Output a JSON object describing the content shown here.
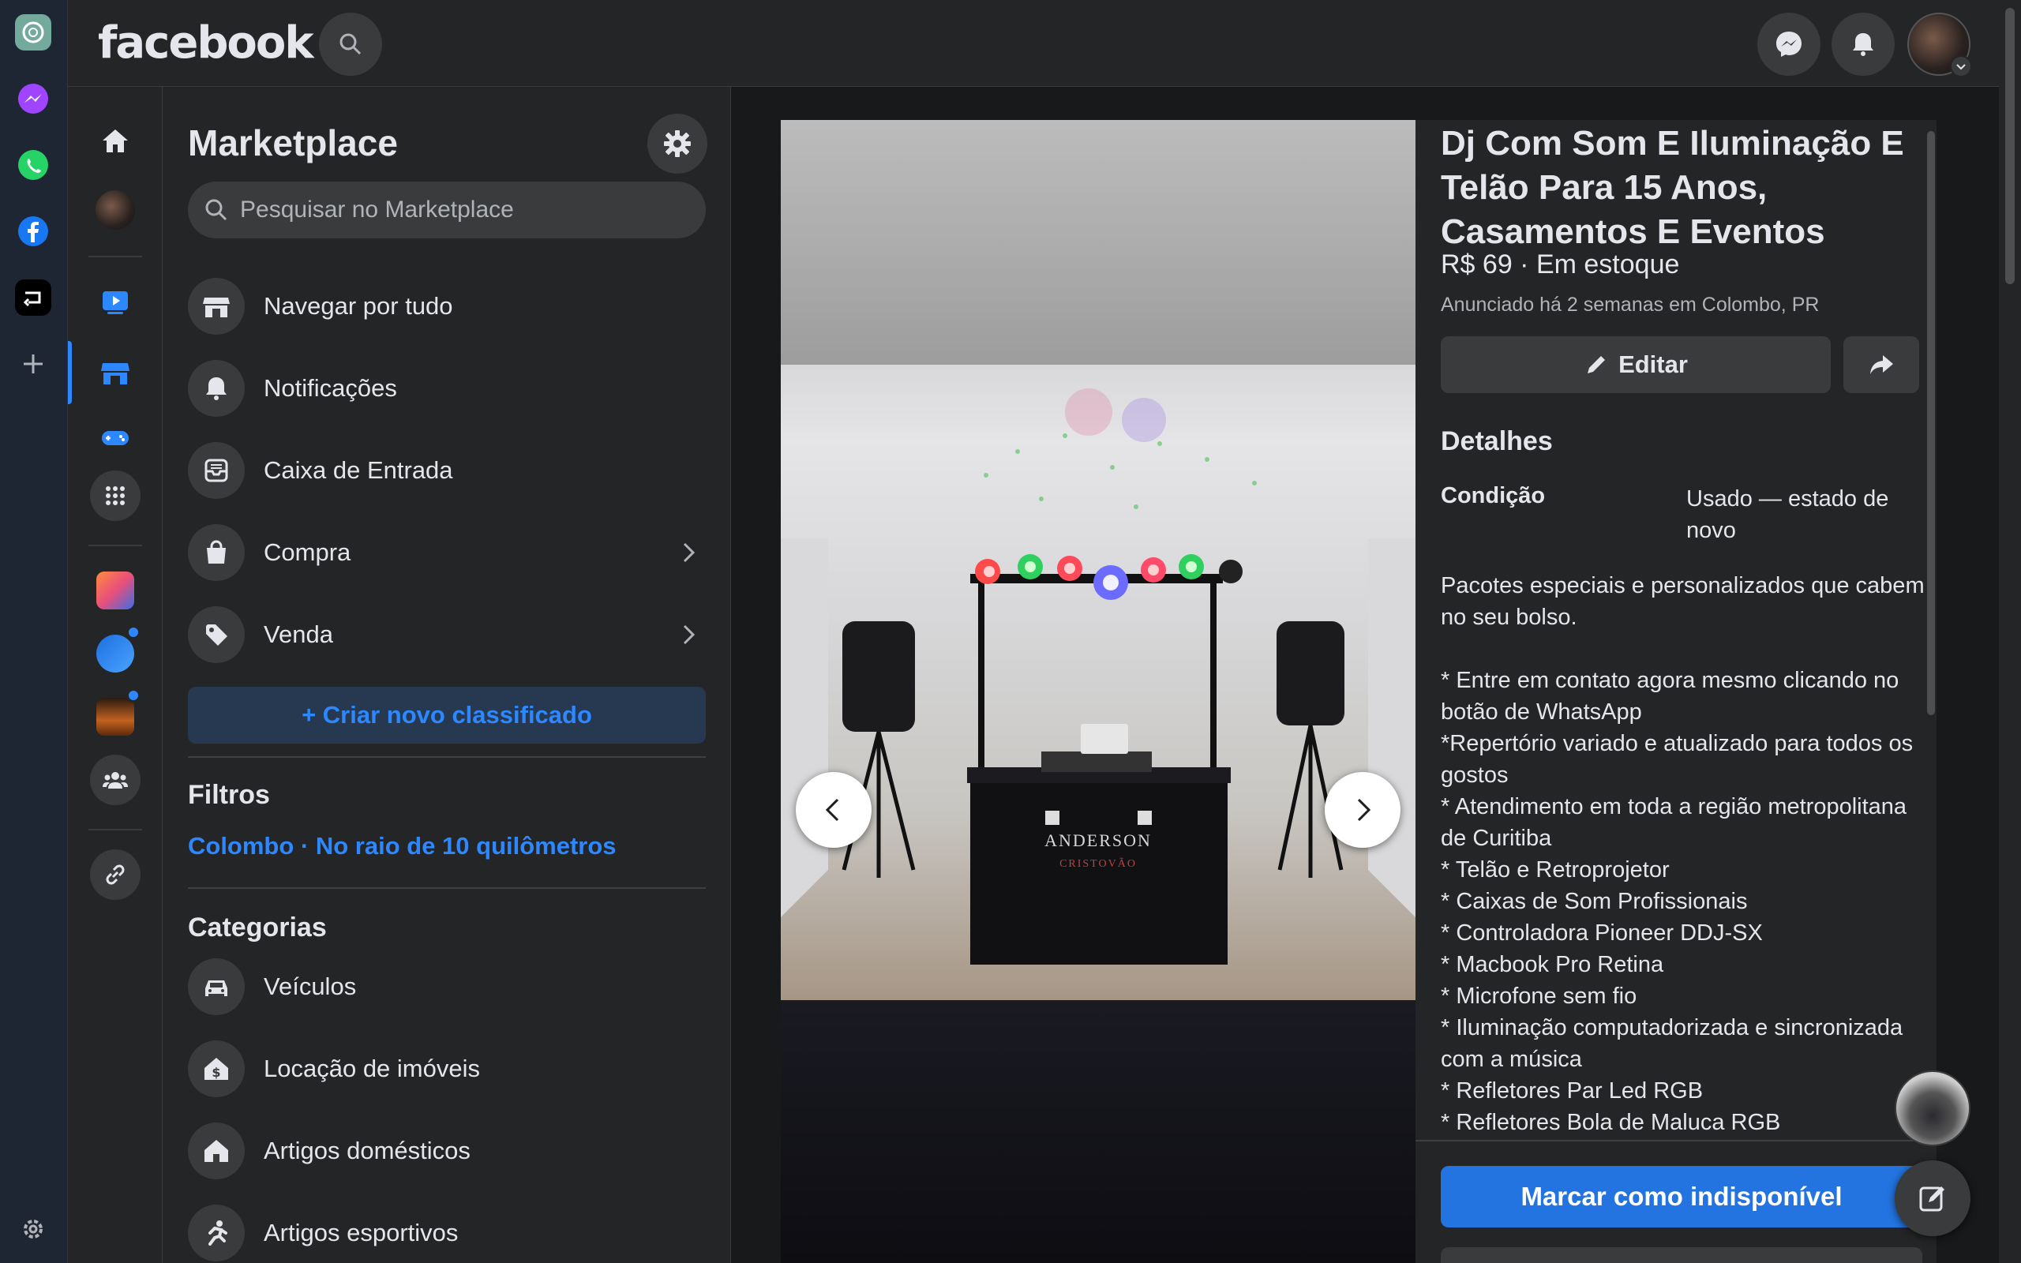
{
  "topbar": {
    "logo": "facebook"
  },
  "sidebar": {
    "title": "Marketplace",
    "search_placeholder": "Pesquisar no Marketplace",
    "items": [
      {
        "label": "Navegar por tudo",
        "icon": "storefront-icon"
      },
      {
        "label": "Notificações",
        "icon": "bell-icon"
      },
      {
        "label": "Caixa de Entrada",
        "icon": "inbox-icon"
      },
      {
        "label": "Compra",
        "icon": "shopping-bag-icon"
      },
      {
        "label": "Venda",
        "icon": "price-tag-icon"
      }
    ],
    "create_label": "+ Criar novo classificado",
    "filters_heading": "Filtros",
    "filter_location": "Colombo · No raio de 10 quilômetros",
    "categories_heading": "Categorias",
    "categories": [
      {
        "label": "Veículos",
        "icon": "car-icon"
      },
      {
        "label": "Locação de imóveis",
        "icon": "house-dollar-icon"
      },
      {
        "label": "Artigos domésticos",
        "icon": "home-icon"
      },
      {
        "label": "Artigos esportivos",
        "icon": "running-icon"
      }
    ]
  },
  "listing": {
    "title": "Dj Com Som E Iluminação E Telão Para 15 Anos, Casamentos E Eventos",
    "price_line": "R$ 69 · Em estoque",
    "meta": "Anunciado há 2 semanas em Colombo, PR",
    "edit_label": "Editar",
    "details_heading": "Detalhes",
    "condition_label": "Condição",
    "condition_value": "Usado — estado de novo",
    "description": "Pacotes especiais e personalizados que cabem no seu bolso.\n\n* Entre em contato agora mesmo clicando no botão de WhatsApp\n*Repertório variado e atualizado para todos os gostos\n* Atendimento em toda a região metropolitana de Curitiba\n* Telão e Retroprojetor\n* Caixas de Som Profissionais\n* Controladora Pioneer DDJ-SX\n* Macbook Pro Retina\n* Microfone sem fio\n* Iluminação computadorizada e sincronizada com a música\n* Refletores Par Led RGB\n* Refletores Bola de Maluca RGB",
    "mark_unavailable_label": "Marcar como indisponível",
    "photo_banner_line1": "ANDERSON",
    "photo_banner_line2": "CRISTOVÃO"
  },
  "colors": {
    "accent": "#2d88ff",
    "primary_button": "#2374e1",
    "background": "#18191a",
    "surface": "#242526"
  }
}
